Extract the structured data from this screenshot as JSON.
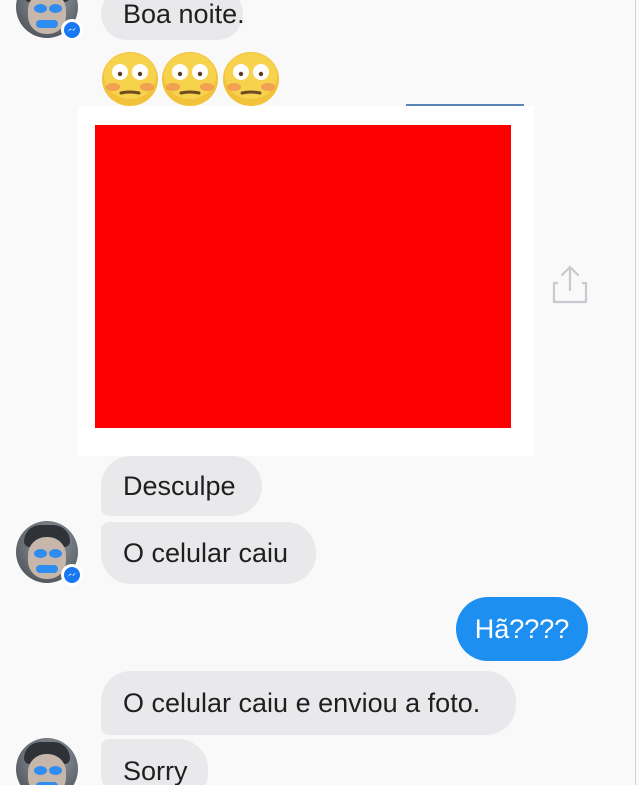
{
  "chat": {
    "messages": [
      {
        "text": "Boa noite.",
        "from": "them"
      },
      {
        "text": "Desculpe",
        "from": "them"
      },
      {
        "text": "O celular caiu",
        "from": "them"
      },
      {
        "text": "Hã????",
        "from": "me"
      },
      {
        "text": "O celular caiu e enviou a foto.",
        "from": "them"
      },
      {
        "text": "Sorry",
        "from": "them"
      }
    ],
    "emojis": [
      "flushed-face",
      "flushed-face",
      "flushed-face"
    ],
    "attachment": {
      "state": "redacted",
      "color": "#ff0000"
    },
    "share_icon": "share-icon"
  },
  "colors": {
    "incoming_bubble": "#e9e9ec",
    "outgoing_bubble": "#1d8ff0",
    "messenger_badge": "#1877f2"
  }
}
